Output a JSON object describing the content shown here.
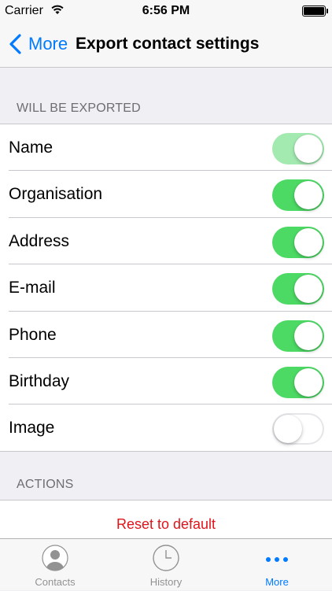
{
  "status_bar": {
    "carrier": "Carrier",
    "time": "6:56 PM"
  },
  "nav": {
    "back_label": "More",
    "title": "Export contact settings"
  },
  "section_exported": {
    "header": "WILL BE EXPORTED",
    "items": [
      {
        "label": "Name",
        "state": "on (dimmed)"
      },
      {
        "label": "Organisation",
        "state": "on"
      },
      {
        "label": "Address",
        "state": "on"
      },
      {
        "label": "E-mail",
        "state": "on"
      },
      {
        "label": "Phone",
        "state": "on"
      },
      {
        "label": "Birthday",
        "state": "on"
      },
      {
        "label": "Image",
        "state": "off"
      }
    ]
  },
  "section_actions": {
    "header": "ACTIONS",
    "reset_label": "Reset to default"
  },
  "tab_bar": {
    "tabs": [
      {
        "label": "Contacts",
        "icon": "person-icon"
      },
      {
        "label": "History",
        "icon": "clock-icon"
      },
      {
        "label": "More",
        "icon": "more-dots-icon",
        "active": true
      }
    ]
  },
  "colors": {
    "accent": "#007aff",
    "toggle_on": "#4cd964",
    "destructive": "#e0141b",
    "background": "#efeff4"
  }
}
